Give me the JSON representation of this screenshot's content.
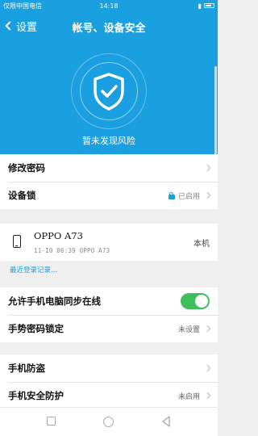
{
  "status_bar": {
    "carrier": "仅限中国电信",
    "time": "14:18"
  },
  "header": {
    "back_label": "设置",
    "title": "帐号、设备安全",
    "status_text": "暂未发现风险"
  },
  "security": {
    "change_password": "修改密码",
    "device_lock": "设备锁",
    "device_lock_value": "已启用"
  },
  "device": {
    "name": "OPPO A73",
    "sub": "11-10 06:39 OPPO A73",
    "tag": "本机"
  },
  "recent_login_link": "最近登录记录...",
  "sync": {
    "allow_sync_label": "允许手机电脑同步在线",
    "allow_sync_on": true,
    "gesture_lock_label": "手势密码锁定",
    "gesture_lock_value": "未设置"
  },
  "protection": {
    "anti_theft_label": "手机防盗",
    "phone_security_label": "手机安全防护",
    "phone_security_value": "未启用"
  },
  "colors": {
    "primary": "#1a9fe0",
    "toggle_on": "#3fbf5a",
    "background": "#efefef"
  }
}
